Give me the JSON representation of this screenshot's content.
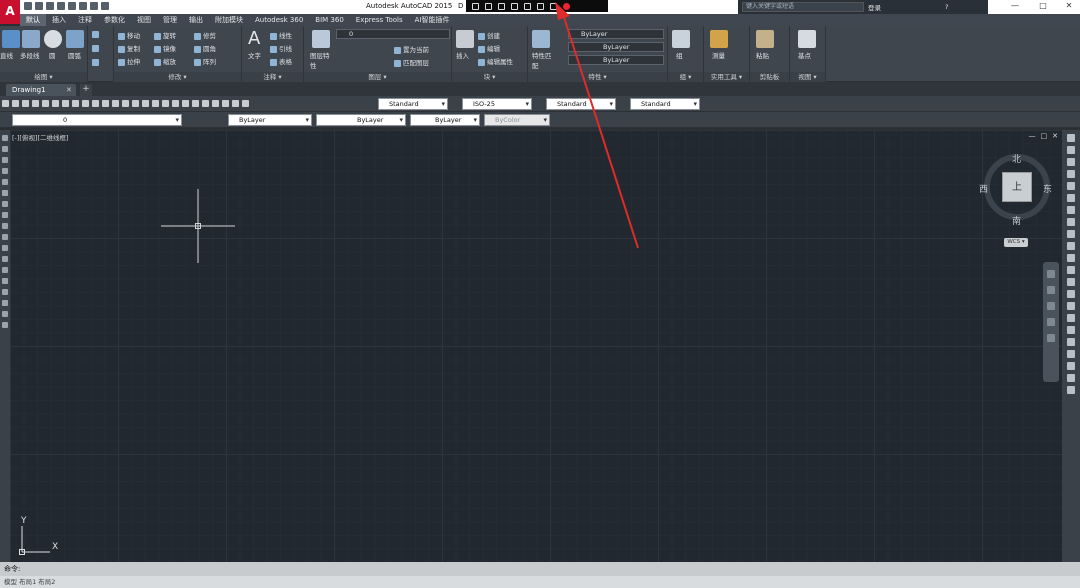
{
  "app": {
    "logo_letter": "A",
    "title": "Autodesk AutoCAD 2015",
    "title_suffix": "D",
    "window_controls": [
      "—",
      "□",
      "✕"
    ]
  },
  "search": {
    "placeholder": "键入关键字或短语",
    "login": "登录",
    "help": "?"
  },
  "ribbon_tabs": [
    "默认",
    "插入",
    "注释",
    "参数化",
    "视图",
    "管理",
    "输出",
    "附加模块",
    "Autodesk 360",
    "BIM 360",
    "Express Tools",
    "AI智能插件"
  ],
  "ribbon": {
    "draw": {
      "title": "绘图 ▾",
      "items": [
        "直线",
        "多段线",
        "圆",
        "圆弧"
      ]
    },
    "modify": {
      "title": "修改 ▾",
      "items": [
        "移动",
        "旋转",
        "修剪",
        "复制",
        "镜像",
        "圆角",
        "拉伸",
        "缩放",
        "阵列"
      ]
    },
    "annotation": {
      "title": "注释 ▾",
      "items": [
        "文字",
        "线性",
        "引线",
        "表格"
      ]
    },
    "layers": {
      "title": "图层 ▾",
      "items": [
        "图层特性",
        "置为当前",
        "匹配图层"
      ],
      "current_layer": "0"
    },
    "block": {
      "title": "块 ▾",
      "items": [
        "插入",
        "创建",
        "编辑",
        "编辑属性"
      ]
    },
    "properties": {
      "title": "特性 ▾",
      "items": [
        "特性匹配"
      ],
      "color": "ByLayer",
      "linetype": "ByLayer",
      "lineweight": "ByLayer"
    },
    "groups": {
      "title": "组 ▾",
      "items": [
        "组"
      ]
    },
    "utilities": {
      "title": "实用工具 ▾",
      "items": [
        "测量"
      ]
    },
    "clipboard": {
      "title": "剪贴板",
      "items": [
        "粘贴"
      ]
    },
    "view": {
      "title": "视图 ▾",
      "items": [
        "基点"
      ]
    }
  },
  "file_tab": {
    "name": "Drawing1",
    "close": "✕",
    "new": "+"
  },
  "toolbar1": {
    "text_style": "Standard",
    "dim_style": "ISO-25",
    "table_style": "Standard",
    "mleader_style": "Standard"
  },
  "toolbar2": {
    "layer": "0",
    "color": "ByLayer",
    "linetype": "ByLayer",
    "lineweight": "ByLayer",
    "plotstyle": "ByColor"
  },
  "viewport": {
    "label": "[-][俯视][二维线框]",
    "controls": [
      "—",
      "□",
      "✕"
    ]
  },
  "viewcube": {
    "top": "上",
    "north": "北",
    "south": "南",
    "east": "东",
    "west": "西",
    "wcs": "WCS ▾"
  },
  "ucs": {
    "x": "X",
    "y": "Y"
  },
  "command": {
    "prompt": "命令:"
  },
  "status": {
    "text": "模型 布局1 布局2"
  },
  "colors": {
    "accent": "#c8102e",
    "canvas": "#212830",
    "arrow": "#e02b2b"
  }
}
